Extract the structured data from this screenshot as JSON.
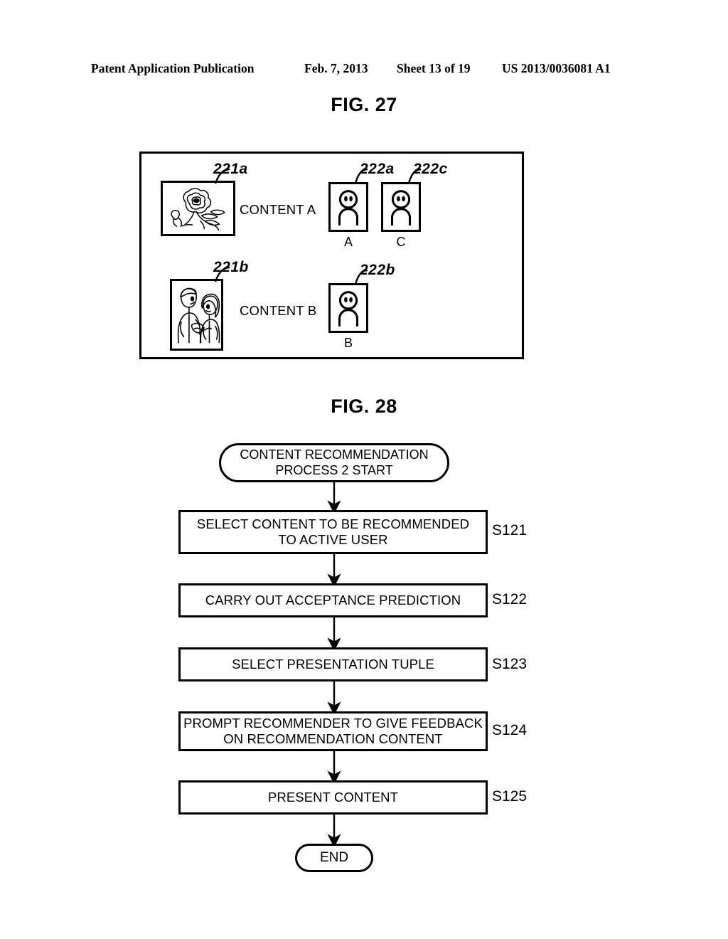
{
  "header": {
    "publication": "Patent Application Publication",
    "date": "Feb. 7, 2013",
    "sheet": "Sheet 13 of 19",
    "pub_number": "US 2013/0036081 A1"
  },
  "fig27": {
    "title": "FIG. 27",
    "rows": [
      {
        "thumb_ref": "221a",
        "thumb_icon": "flower-line-art",
        "content_label": "CONTENT A",
        "users": [
          {
            "ref": "222a",
            "name": "A",
            "icon": "person-icon"
          },
          {
            "ref": "222c",
            "name": "C",
            "icon": "person-icon"
          }
        ]
      },
      {
        "thumb_ref": "221b",
        "thumb_icon": "two-people-line-art",
        "content_label": "CONTENT B",
        "users": [
          {
            "ref": "222b",
            "name": "B",
            "icon": "person-icon"
          }
        ]
      }
    ]
  },
  "fig28": {
    "title": "FIG. 28",
    "start_label": "CONTENT RECOMMENDATION\nPROCESS 2 START",
    "end_label": "END",
    "steps": [
      {
        "id": "S121",
        "text": "SELECT CONTENT TO BE RECOMMENDED\nTO ACTIVE USER"
      },
      {
        "id": "S122",
        "text": "CARRY OUT ACCEPTANCE PREDICTION"
      },
      {
        "id": "S123",
        "text": "SELECT PRESENTATION TUPLE"
      },
      {
        "id": "S124",
        "text": "PROMPT RECOMMENDER TO GIVE FEEDBACK\nON RECOMMENDATION CONTENT"
      },
      {
        "id": "S125",
        "text": "PRESENT CONTENT"
      }
    ]
  },
  "colors": {
    "ink": "#000000",
    "paper": "#ffffff"
  }
}
